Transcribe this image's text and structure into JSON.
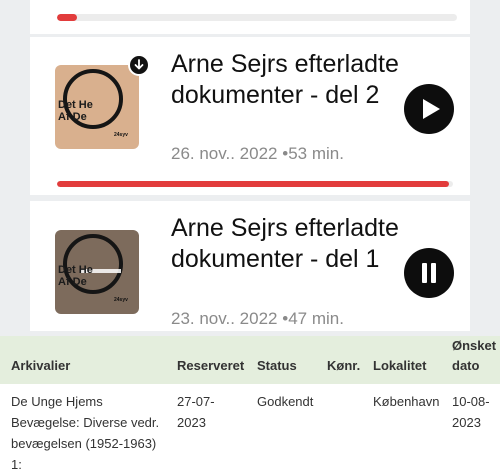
{
  "episodes": [
    {
      "title": "Arne Sejrs efterladte dokumenter - del 2",
      "date": "26. nov.. 2022",
      "separator": "•",
      "duration": "53 min.",
      "thumb_line1": "Det He",
      "thumb_line2": "Af De",
      "thumb_tag": "24syv",
      "progress_fraction": 0.99,
      "downloaded": true,
      "control": "play"
    },
    {
      "title": "Arne Sejrs efterladte dokumenter - del 1",
      "date": "23. nov.. 2022",
      "separator": "•",
      "duration": "47 min.",
      "thumb_line1": "Det He",
      "thumb_line2": "Af De",
      "thumb_tag": "24syv",
      "downloaded": false,
      "control": "pause"
    }
  ],
  "top_progress_fraction": 0.05,
  "colors": {
    "accent": "#e23c3c",
    "header_bg": "#e4eedd"
  },
  "table": {
    "headers": {
      "arkivalier": "Arkivalier",
      "reserveret": "Reserveret",
      "status": "Status",
      "konr": "Kønr.",
      "lokalitet": "Lokalitet",
      "onsket_line1": "Ønsket",
      "onsket_line2": "dato"
    },
    "row": {
      "arkivalier": [
        "De Unge Hjems",
        "Bevægelse: Diverse vedr.",
        "bevægelsen (1952-1963)",
        "1:"
      ],
      "reserveret": [
        "27-07-",
        "2023"
      ],
      "status": "Godkendt",
      "konr": "",
      "lokalitet": "København",
      "onsket": [
        "10-08-",
        "2023"
      ]
    }
  }
}
